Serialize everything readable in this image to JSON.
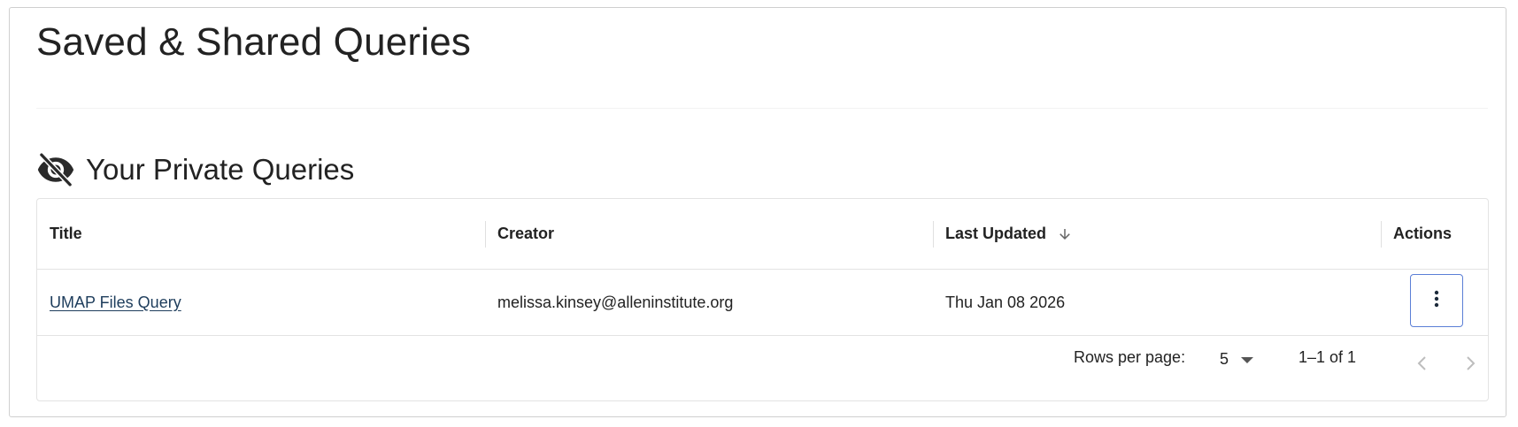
{
  "page": {
    "title": "Saved & Shared Queries"
  },
  "section": {
    "title": "Your Private Queries",
    "icon": "eye-off-icon"
  },
  "table": {
    "columns": [
      {
        "key": "title",
        "label": "Title"
      },
      {
        "key": "creator",
        "label": "Creator"
      },
      {
        "key": "last_updated",
        "label": "Last Updated",
        "sort": "descending"
      },
      {
        "key": "actions",
        "label": "Actions"
      }
    ],
    "rows": [
      {
        "title": "UMAP Files Query",
        "creator": "melissa.kinsey@alleninstitute.org",
        "last_updated": "Thu Jan 08 2026",
        "actions_icon": "more-vertical-icon"
      }
    ]
  },
  "pagination": {
    "rows_per_page_label": "Rows per page:",
    "rows_per_page_value": "5",
    "range_text": "1–1 of 1",
    "prev_icon": "chevron-left-icon",
    "next_icon": "chevron-right-icon"
  },
  "colors": {
    "link": "#1e3d5c",
    "focus_border": "#5b7fd6",
    "border": "#e3e3e3",
    "disabled_icon": "#bdbdbd"
  }
}
